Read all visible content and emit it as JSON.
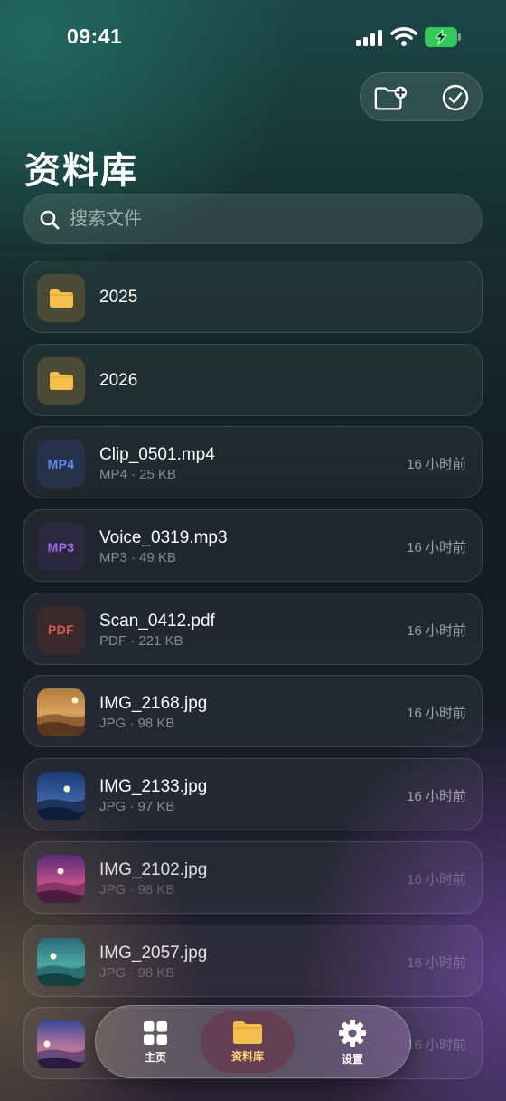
{
  "status_bar": {
    "time": "09:41"
  },
  "header": {
    "title": "资料库"
  },
  "search": {
    "placeholder": "搜索文件",
    "value": ""
  },
  "files": [
    {
      "kind": "folder",
      "name": "2025"
    },
    {
      "kind": "folder",
      "name": "2026"
    },
    {
      "kind": "video",
      "badge": "MP4",
      "name": "Clip_0501.mp4",
      "meta": "MP4 · 25 KB",
      "time": "16 小时前"
    },
    {
      "kind": "audio",
      "badge": "MP3",
      "name": "Voice_0319.mp3",
      "meta": "MP3 · 49 KB",
      "time": "16 小时前"
    },
    {
      "kind": "pdf",
      "badge": "PDF",
      "name": "Scan_0412.pdf",
      "meta": "PDF · 221 KB",
      "time": "16 小时前"
    },
    {
      "kind": "image",
      "thumb": "desert-sunset",
      "name": "IMG_2168.jpg",
      "meta": "JPG · 98 KB",
      "time": "16 小时前"
    },
    {
      "kind": "image",
      "thumb": "blue-night",
      "name": "IMG_2133.jpg",
      "meta": "JPG · 97 KB",
      "time": "16 小时前"
    },
    {
      "kind": "image",
      "thumb": "purple-dusk",
      "name": "IMG_2102.jpg",
      "meta": "JPG · 98 KB",
      "time": "16 小时前"
    },
    {
      "kind": "image",
      "thumb": "teal-hills",
      "name": "IMG_2057.jpg",
      "meta": "JPG · 98 KB",
      "time": "16 小时前"
    },
    {
      "kind": "image",
      "thumb": "violet-sunset",
      "name": "",
      "meta": "",
      "time": "16 小时前"
    }
  ],
  "tab_bar": {
    "home_label": "主页",
    "library_label": "资料库",
    "settings_label": "设置",
    "active": "library"
  },
  "colors": {
    "folder": "#f5c04a",
    "mp4": "#5b8ff0",
    "mp3": "#a06bf0",
    "pdf": "#e0584a",
    "battery": "#34c759",
    "active_tab_label": "#ffd27a"
  }
}
